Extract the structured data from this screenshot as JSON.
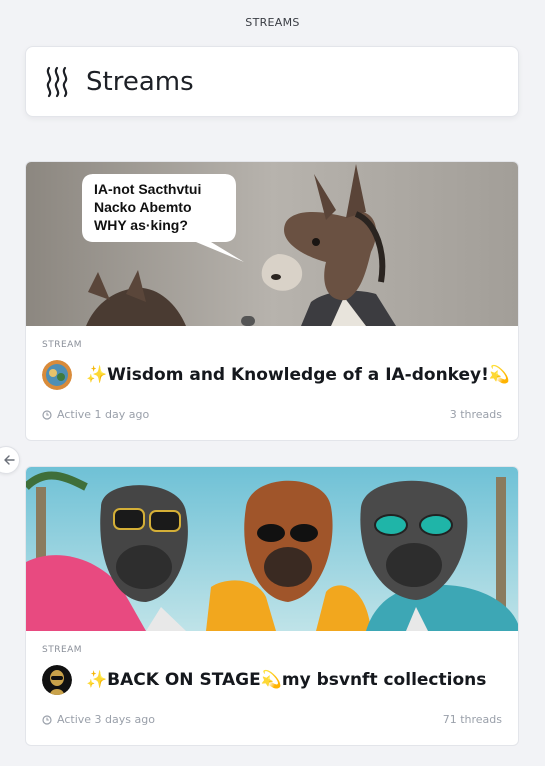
{
  "page": {
    "section_label": "STREAMS"
  },
  "header": {
    "title": "Streams",
    "icon": "streams-waves-icon"
  },
  "nav": {
    "back_icon": "arrow-left-icon"
  },
  "streams": [
    {
      "type_label": "STREAM",
      "title": "✨Wisdom and Knowledge of a IA-donkey!💫",
      "speech_bubble": "IA-not Sacthvtui Nacko Abemto WHY as·king?",
      "active": "Active 1 day ago",
      "threads": "3 threads"
    },
    {
      "type_label": "STREAM",
      "title": "✨BACK ON STAGE💫my bsvnft collections",
      "active": "Active 3 days ago",
      "threads": "71 threads"
    }
  ],
  "colors": {
    "background": "#f2f3f6",
    "card": "#ffffff",
    "muted": "#9aa0aa",
    "title": "#15181d"
  }
}
